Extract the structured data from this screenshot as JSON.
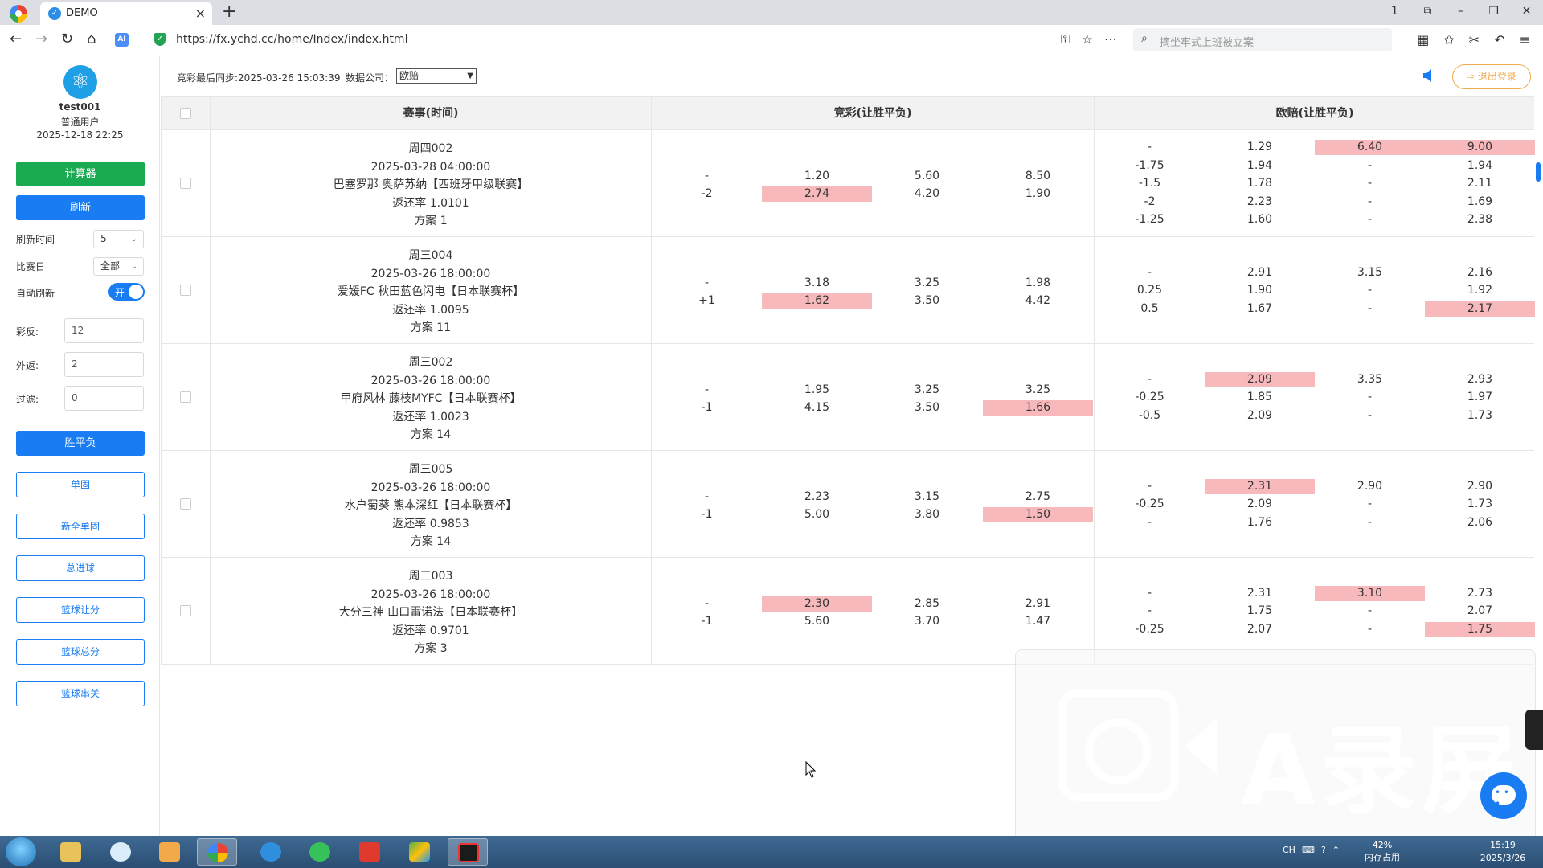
{
  "browser": {
    "tab_title": "DEMO",
    "tab_close": "×",
    "new_tab": "+",
    "url": "https://fx.ychd.cc/home/Index/index.html",
    "search_placeholder": "摘坐牢式上班被立案",
    "window_controls": [
      "1",
      "⧉",
      "–",
      "❐",
      "✕"
    ],
    "ai_badge": "AI"
  },
  "user": {
    "name": "test001",
    "role": "普通用户",
    "datetime": "2025-12-18 22:25"
  },
  "sidebar": {
    "calculator_button": "计算器",
    "refresh_button": "刷新",
    "refresh_time_label": "刷新时间",
    "refresh_time_value": "5",
    "match_day_label": "比赛日",
    "match_day_value": "全部",
    "auto_refresh_label": "自动刷新",
    "auto_refresh_value": "开",
    "caifan_label": "彩反:",
    "caifan_value": "12",
    "waifan_label": "外返:",
    "waifan_value": "2",
    "filter_label": "过滤:",
    "filter_value": "0",
    "nav_items": [
      "胜平负",
      "单固",
      "新全单固",
      "总进球",
      "篮球让分",
      "篮球总分",
      "篮球串关"
    ]
  },
  "topbar": {
    "sync_text": "竞彩最后同步:2025-03-26 15:03:39",
    "company_label": "数据公司：",
    "company_value": "欧赔",
    "logout_label": "⇨ 退出登录"
  },
  "table": {
    "headers": [
      "赛事(时间)",
      "竞彩(让胜平负)",
      "欧赔(让胜平负)"
    ],
    "rows": [
      {
        "match": [
          "周四002",
          "2025-03-28 04:00:00",
          "巴塞罗那 奥萨苏纳【西班牙甲级联赛】",
          "返还率 1.0101",
          "方案 1"
        ],
        "jc": [
          [
            "-",
            "1.20",
            "5.60",
            "8.50"
          ],
          [
            "-2",
            "2.74",
            "4.20",
            "1.90"
          ]
        ],
        "jc_hl": [
          [
            1,
            1
          ]
        ],
        "eu": [
          [
            "-",
            "1.29",
            "6.40",
            "9.00"
          ],
          [
            "-1.75",
            "1.94",
            "-",
            "1.94"
          ],
          [
            "-1.5",
            "1.78",
            "-",
            "2.11"
          ],
          [
            "-2",
            "2.23",
            "-",
            "1.69"
          ],
          [
            "-1.25",
            "1.60",
            "-",
            "2.38"
          ]
        ],
        "eu_hl": [
          [
            0,
            2
          ],
          [
            0,
            3
          ]
        ]
      },
      {
        "match": [
          "周三004",
          "2025-03-26 18:00:00",
          "爱媛FC 秋田蓝色闪电【日本联赛杯】",
          "返还率 1.0095",
          "方案 11"
        ],
        "jc": [
          [
            "-",
            "3.18",
            "3.25",
            "1.98"
          ],
          [
            "+1",
            "1.62",
            "3.50",
            "4.42"
          ]
        ],
        "jc_hl": [
          [
            1,
            1
          ]
        ],
        "eu": [
          [
            "-",
            "2.91",
            "3.15",
            "2.16"
          ],
          [
            "0.25",
            "1.90",
            "-",
            "1.92"
          ],
          [
            "0.5",
            "1.67",
            "-",
            "2.17"
          ]
        ],
        "eu_hl": [
          [
            2,
            3
          ]
        ]
      },
      {
        "match": [
          "周三002",
          "2025-03-26 18:00:00",
          "甲府风林 藤枝MYFC【日本联赛杯】",
          "返还率 1.0023",
          "方案 14"
        ],
        "jc": [
          [
            "-",
            "1.95",
            "3.25",
            "3.25"
          ],
          [
            "-1",
            "4.15",
            "3.50",
            "1.66"
          ]
        ],
        "jc_hl": [
          [
            1,
            3
          ]
        ],
        "eu": [
          [
            "-",
            "2.09",
            "3.35",
            "2.93"
          ],
          [
            "-0.25",
            "1.85",
            "-",
            "1.97"
          ],
          [
            "-0.5",
            "2.09",
            "-",
            "1.73"
          ]
        ],
        "eu_hl": [
          [
            0,
            1
          ]
        ]
      },
      {
        "match": [
          "周三005",
          "2025-03-26 18:00:00",
          "水户蜀葵 熊本深红【日本联赛杯】",
          "返还率 0.9853",
          "方案 14"
        ],
        "jc": [
          [
            "-",
            "2.23",
            "3.15",
            "2.75"
          ],
          [
            "-1",
            "5.00",
            "3.80",
            "1.50"
          ]
        ],
        "jc_hl": [
          [
            1,
            3
          ]
        ],
        "eu": [
          [
            "-",
            "2.31",
            "2.90",
            "2.90"
          ],
          [
            "-0.25",
            "2.09",
            "-",
            "1.73"
          ],
          [
            "-",
            "1.76",
            "-",
            "2.06"
          ]
        ],
        "eu_hl": [
          [
            0,
            1
          ]
        ]
      },
      {
        "match": [
          "周三003",
          "2025-03-26 18:00:00",
          "大分三神 山口雷诺法【日本联赛杯】",
          "返还率 0.9701",
          "方案 3"
        ],
        "jc": [
          [
            "-",
            "2.30",
            "2.85",
            "2.91"
          ],
          [
            "-1",
            "5.60",
            "3.70",
            "1.47"
          ]
        ],
        "jc_hl": [
          [
            0,
            1
          ]
        ],
        "eu": [
          [
            "-",
            "2.31",
            "3.10",
            "2.73"
          ],
          [
            "-",
            "1.75",
            "-",
            "2.07"
          ],
          [
            "-0.25",
            "2.07",
            "-",
            "1.75"
          ]
        ],
        "eu_hl": [
          [
            0,
            2
          ],
          [
            2,
            3
          ]
        ]
      }
    ]
  },
  "watermark": {
    "text": "A录屏"
  },
  "taskbar": {
    "tray_items": [
      "CH",
      "⌨",
      "?",
      "⌃"
    ],
    "memory_percent": "42%",
    "memory_label": "内存占用",
    "time": "15:19",
    "date": "2025/3/26"
  },
  "colors": {
    "accent_blue": "#1a7cf2",
    "accent_green": "#1aab52",
    "highlight_pink": "#f8b9bd",
    "logout_orange": "#f0ad4e"
  }
}
